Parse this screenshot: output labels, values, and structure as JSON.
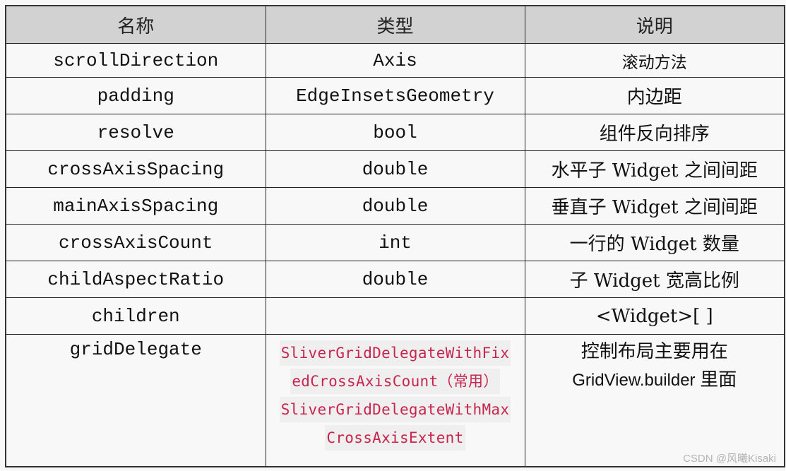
{
  "table": {
    "headers": [
      "名称",
      "类型",
      "说明"
    ],
    "rows": [
      {
        "name": "scrollDirection",
        "type": "Axis",
        "desc": "滚动方法"
      },
      {
        "name": "padding",
        "type": "EdgeInsetsGeometry",
        "desc": "内边距"
      },
      {
        "name": "resolve",
        "type": "bool",
        "desc": "组件反向排序"
      },
      {
        "name": "crossAxisSpacing",
        "type": "double",
        "desc": "水平子 Widget 之间间距"
      },
      {
        "name": "mainAxisSpacing",
        "type": "double",
        "desc": "垂直子 Widget 之间间距"
      },
      {
        "name": "crossAxisCount",
        "type": "int",
        "desc": "一行的 Widget 数量"
      },
      {
        "name": "childAspectRatio",
        "type": "double",
        "desc": "子 Widget 宽高比例"
      },
      {
        "name": "children",
        "type": "",
        "desc": "<Widget>[ ]"
      }
    ],
    "last_row": {
      "name": "gridDelegate",
      "type_lines": [
        "SliverGridDelegateWithFix",
        "edCrossAxisCount（常用）",
        "SliverGridDelegateWithMax",
        "CrossAxisExtent"
      ],
      "desc_line1": "控制布局主要用在",
      "desc_line2_latin": "GridView.builder",
      "desc_line2_cjk": "里面"
    }
  },
  "colors": {
    "header_bg": "#d2d2d2",
    "code_text": "#c7254e",
    "code_bg": "#efefef",
    "page_bg": "#f8f8f8"
  },
  "watermark": "CSDN @风曦Kisaki"
}
